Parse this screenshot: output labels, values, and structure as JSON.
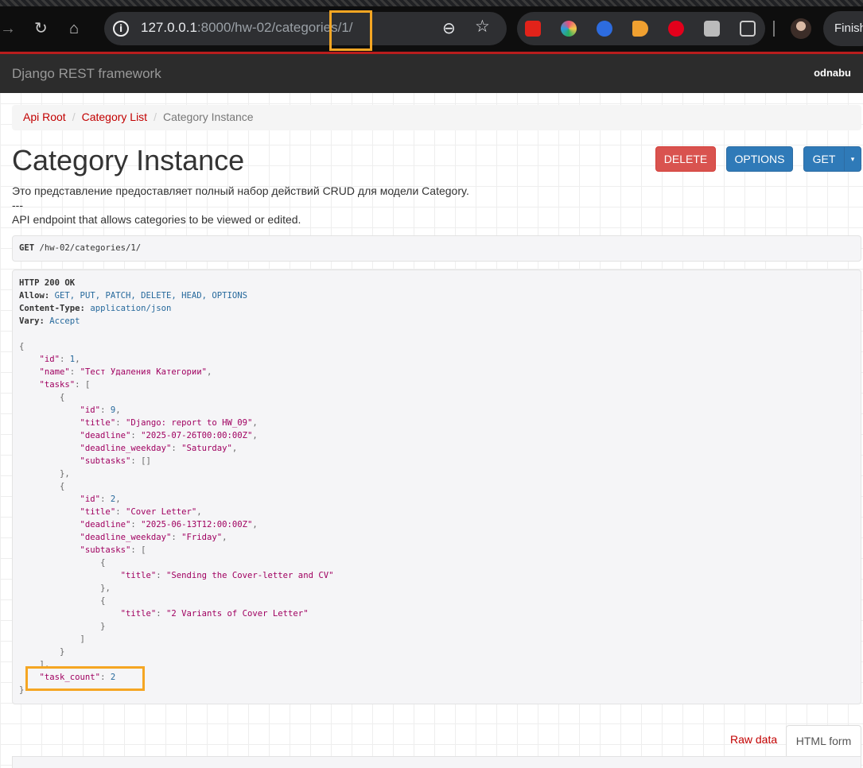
{
  "browser": {
    "url_host": "127.0.0.1",
    "url_rest": ":8000/hw-02/categories/1/",
    "finish_label": "Finish"
  },
  "navbar": {
    "brand": "Django REST framework",
    "user": "odnabu"
  },
  "breadcrumb": {
    "items": [
      "Api Root",
      "Category List",
      "Category Instance"
    ]
  },
  "page": {
    "title": "Category Instance",
    "description_ru": "Это представление предоставляет полный набор действий CRUD для модели Category.",
    "description_sep": "---",
    "description_en": "API endpoint that allows categories to be viewed or edited."
  },
  "buttons": {
    "delete": "DELETE",
    "options": "OPTIONS",
    "get": "GET",
    "caret": "▾"
  },
  "request": {
    "method": "GET",
    "path": "/hw-02/categories/1/"
  },
  "response": {
    "status": "HTTP 200 OK",
    "allow_key": "Allow:",
    "allow_val": "GET, PUT, PATCH, DELETE, HEAD, OPTIONS",
    "ctype_key": "Content-Type:",
    "ctype_val": "application/json",
    "vary_key": "Vary:",
    "vary_val": "Accept"
  },
  "json_body": {
    "id": 1,
    "name": "Тест Удаления Категории",
    "tasks": [
      {
        "id": 9,
        "title": "Django: report to HW_09",
        "deadline": "2025-07-26T00:00:00Z",
        "deadline_weekday": "Saturday",
        "subtasks": []
      },
      {
        "id": 2,
        "title": "Cover Letter",
        "deadline": "2025-06-13T12:00:00Z",
        "deadline_weekday": "Friday",
        "subtasks": [
          {
            "title": "Sending the Cover-letter and CV"
          },
          {
            "title": "2 Variants of Cover Letter"
          }
        ]
      }
    ],
    "task_count": 2
  },
  "form_tabs": {
    "raw": "Raw data",
    "html": "HTML form"
  },
  "colors": {
    "navbar": "#2c2c2c",
    "link_red": "#c20000",
    "delete_btn": "#d9534f",
    "primary_btn": "#2f7ab8",
    "highlight": "#f5a623"
  }
}
